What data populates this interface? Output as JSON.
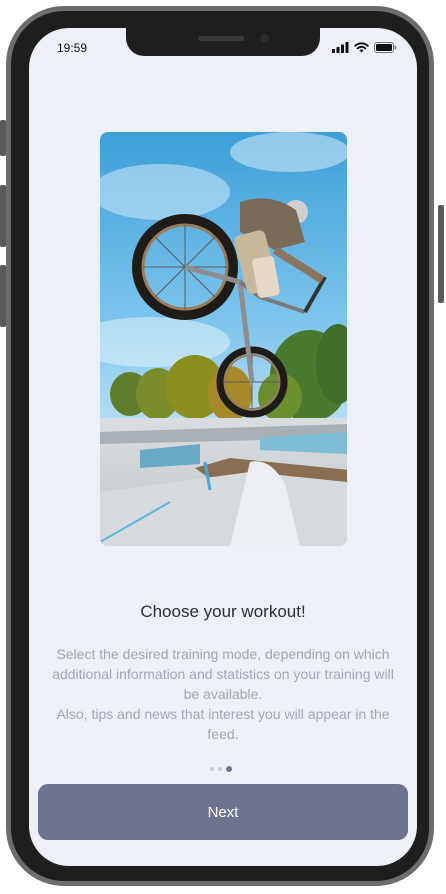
{
  "status_bar": {
    "time": "19:59",
    "icons": [
      "signal-icon",
      "wifi-icon",
      "battery-icon"
    ]
  },
  "onboarding": {
    "image": "bmx-rider-jumping-photo",
    "title": "Choose your workout!",
    "description_line1": "Select the desired training mode, depending on which additional information and statistics on your training will be available.",
    "description_line2": "Also, tips and news that interest you will appear in the feed.",
    "pagination": {
      "total": 3,
      "active_index": 2
    },
    "next_label": "Next"
  },
  "colors": {
    "background": "#eef0f8",
    "button": "#6e7490",
    "title": "#2a2d3a",
    "description": "#a2a6b6"
  }
}
